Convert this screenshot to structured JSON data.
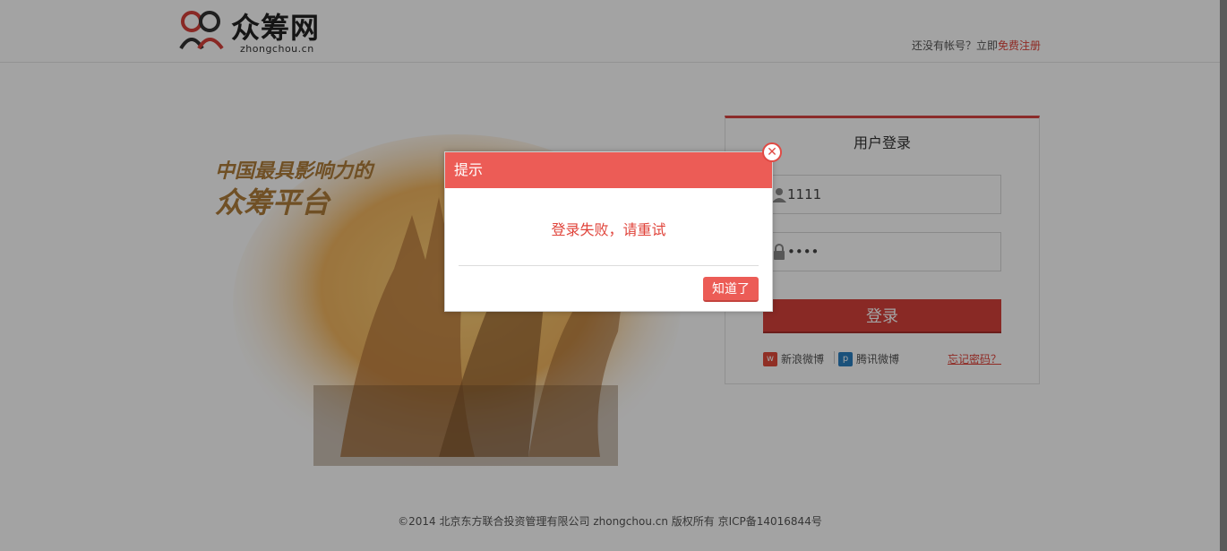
{
  "header": {
    "logo_text": "众筹网",
    "logo_sub": "zhongchou.cn",
    "signup_prompt": "还没有帐号？立即",
    "signup_link": "免费注册"
  },
  "banner": {
    "slogan_line1": "中国最具影响力的",
    "slogan_line2": "众筹平台"
  },
  "login": {
    "title": "用户登录",
    "username_value": "1111",
    "password_value": "1111",
    "submit_label": "登录",
    "social_sina": "新浪微博",
    "social_tencent": "腾讯微博",
    "forgot_label": "忘记密码？"
  },
  "footer": {
    "copyright": "©2014 北京东方联合投资管理有限公司 zhongchou.cn 版权所有 京ICP备14016844号"
  },
  "dialog": {
    "title": "提示",
    "message": "登录失败，请重试",
    "ok_label": "知道了",
    "close_glyph": "✕"
  },
  "colors": {
    "accent": "#ec5c56",
    "accent_dark": "#d6403a",
    "link": "#e0443b"
  }
}
